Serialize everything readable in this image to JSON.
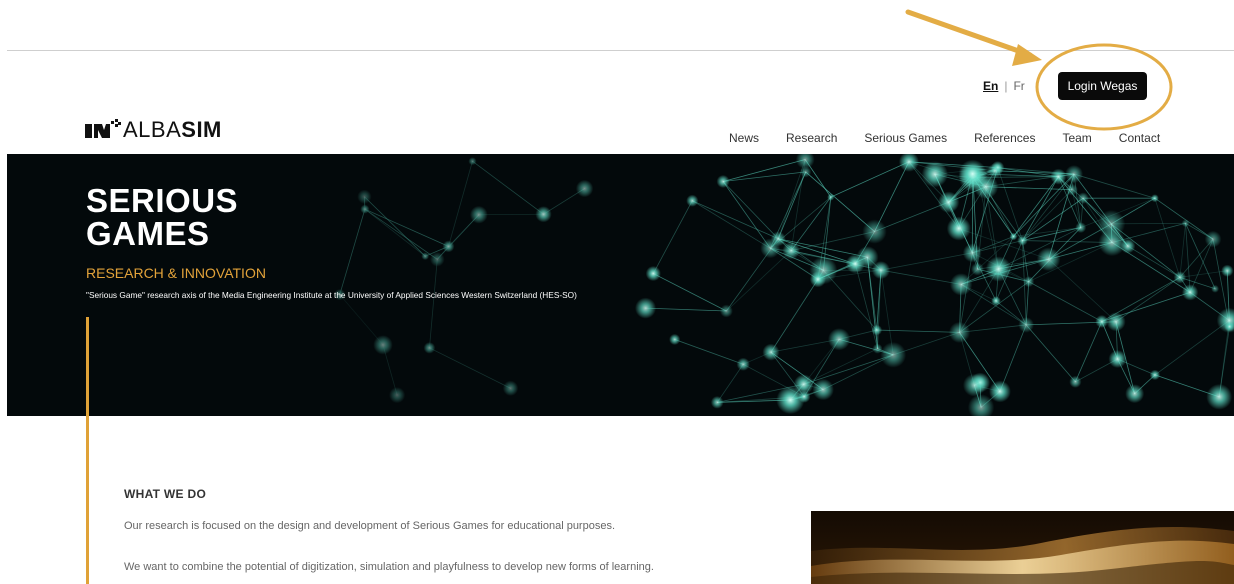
{
  "header": {
    "logo_text_light": "ALBA",
    "logo_text_bold": "SIM",
    "languages": [
      "En",
      "Fr"
    ],
    "active_language": "En",
    "login_label": "Login Wegas",
    "nav": [
      "News",
      "Research",
      "Serious Games",
      "References",
      "Team",
      "Contact"
    ]
  },
  "hero": {
    "title_line1": "SERIOUS",
    "title_line2": "GAMES",
    "subtitle": "RESEARCH & INNOVATION",
    "description": "\"Serious Game\" research axis of the Media Engineering Institute at the University of Applied Sciences Western Switzerland (HES-SO)"
  },
  "what_we_do": {
    "heading": "WHAT WE DO",
    "paragraphs": [
      "Our research is focused on the design and development of Serious Games for educational purposes.",
      "We want to combine the potential of digitization, simulation and playfulness to develop new forms of learning."
    ]
  },
  "colors": {
    "accent": "#e0a237",
    "hero_bg": "#03090b",
    "network": "#5fe0c9",
    "button": "#0a0a0a"
  }
}
